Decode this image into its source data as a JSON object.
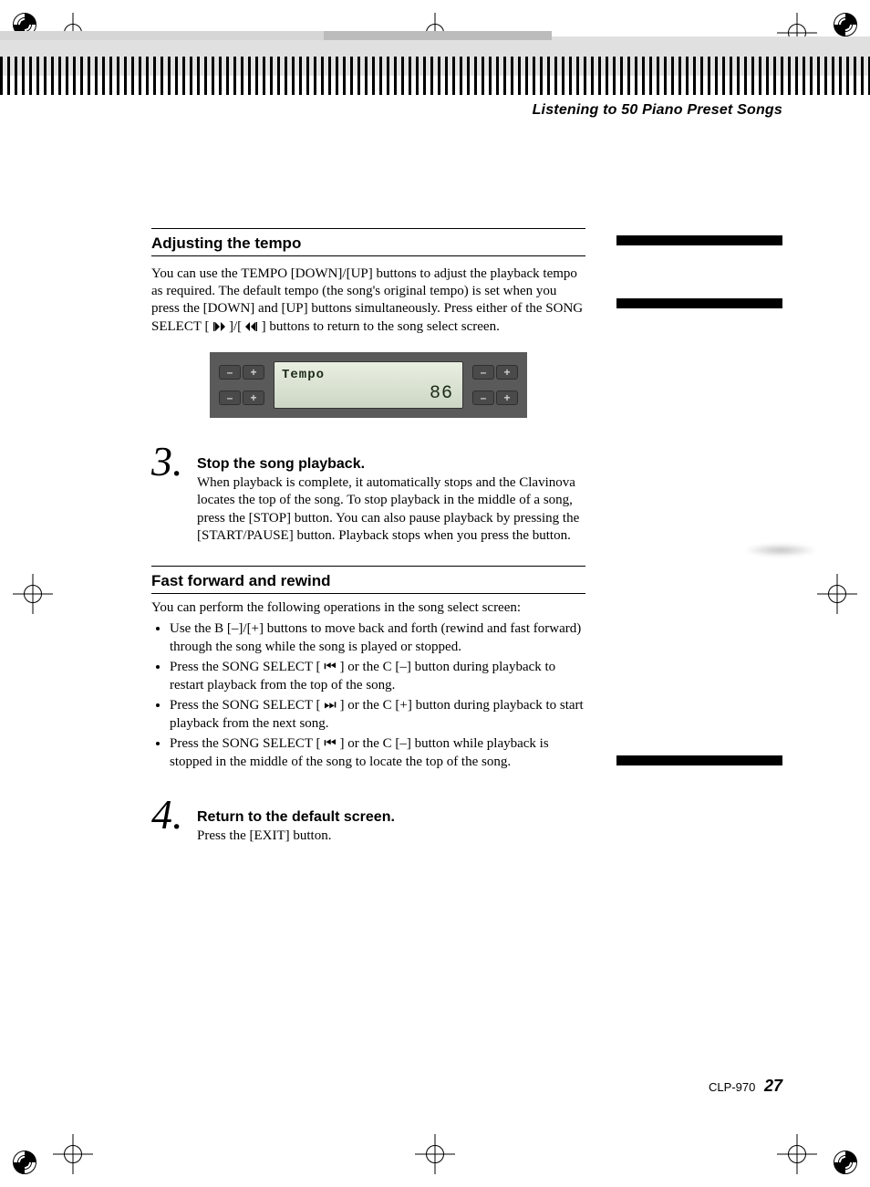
{
  "running_head": "Listening to 50 Piano Preset Songs",
  "section1": {
    "title": "Adjusting the tempo",
    "para": "You can use the TEMPO [DOWN]/[UP] buttons to adjust the playback tempo as required. The default tempo (the song's original tempo) is set when you press the [DOWN] and [UP] buttons simultaneously.\nPress either of the SONG SELECT [ ",
    "para_tail": " ] buttons to return to the song select screen."
  },
  "lcd": {
    "label": "Tempo",
    "value": "86",
    "minus": "–",
    "plus": "+"
  },
  "step3": {
    "num": "3",
    "title": "Stop the song playback.",
    "body": "When playback is complete, it automatically stops and the Clavinova locates the top of the song. To stop playback in the middle of a song, press the [STOP] button. You can also pause playback by pressing the [START/PAUSE] button. Playback stops when you press the button."
  },
  "section2": {
    "title": "Fast forward and rewind",
    "lead": "You can perform the following operations in the song select screen:",
    "bullets": [
      "Use the B [–]/[+] buttons to move back and forth (rewind and fast forward) through the song while the song is played or stopped.",
      "Press the SONG SELECT [ ⏮ ] or the C [–] button during playback to restart playback from the top of the song.",
      "Press the SONG SELECT [ ⏭ ] or the C [+] button during playback to start playback from the next song.",
      "Press the SONG SELECT [ ⏮ ] or the C [–] button while playback is stopped in the middle of the song to locate the top of the song."
    ]
  },
  "step4": {
    "num": "4",
    "title": "Return to the default screen.",
    "body": "Press the [EXIT] button."
  },
  "footer": {
    "model": "CLP-970",
    "page": "27"
  }
}
